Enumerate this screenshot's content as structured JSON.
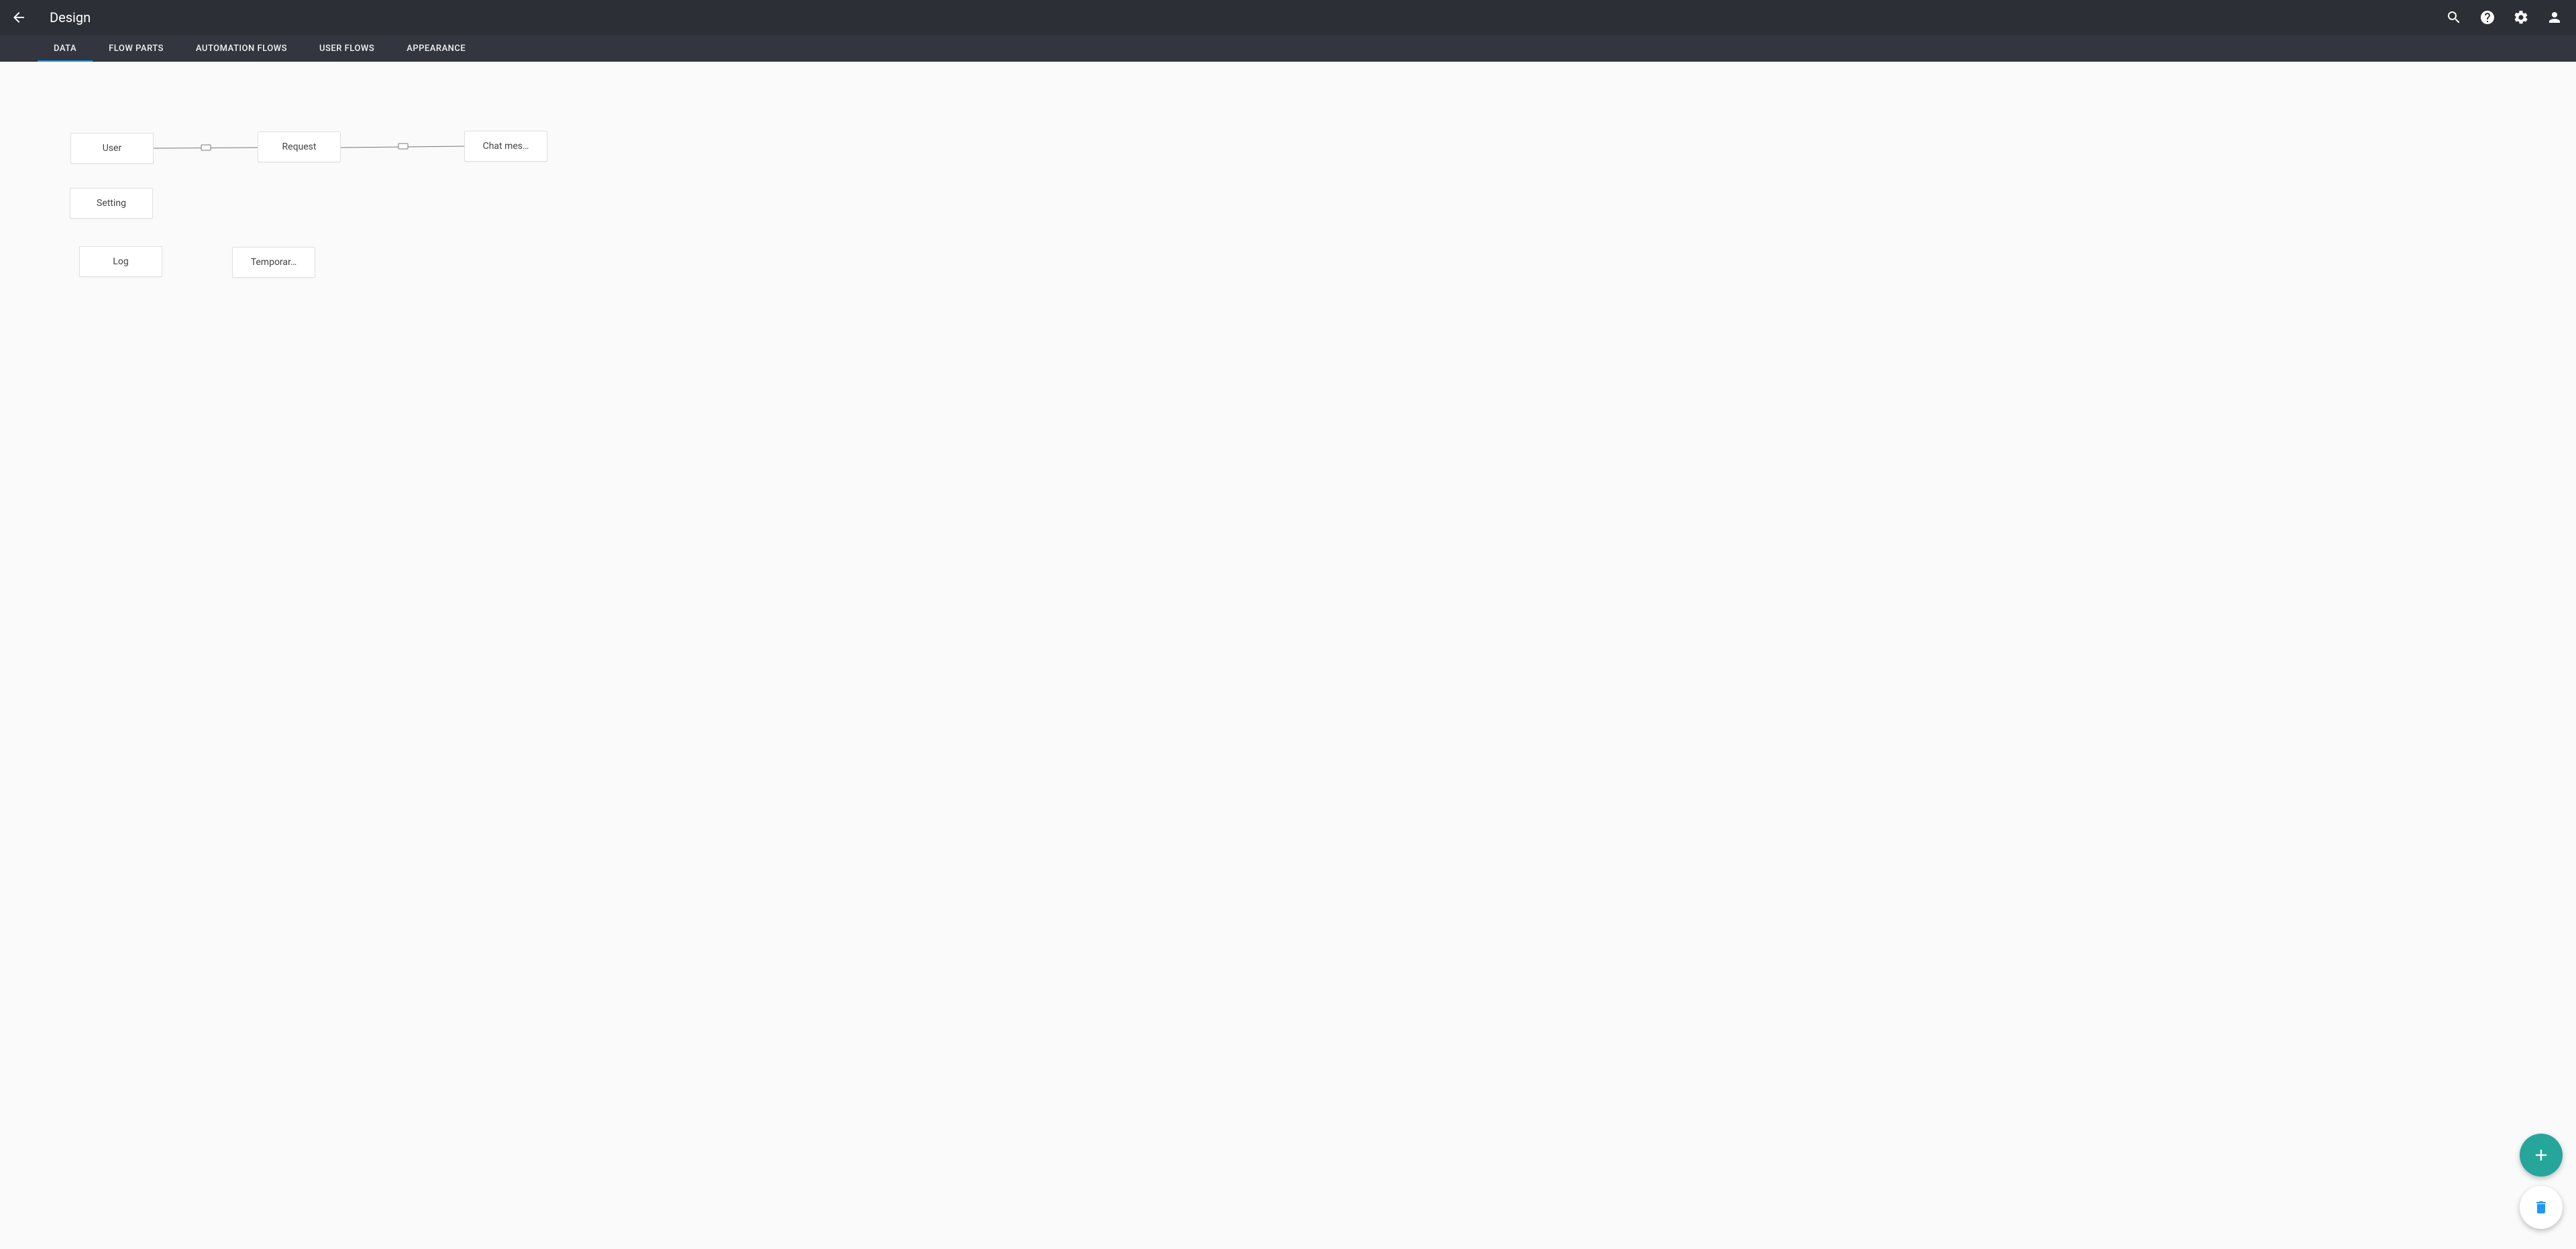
{
  "header": {
    "title": "Design"
  },
  "tabs": [
    {
      "label": "DATA",
      "active": true
    },
    {
      "label": "FLOW PARTS",
      "active": false
    },
    {
      "label": "AUTOMATION FLOWS",
      "active": false
    },
    {
      "label": "USER FLOWS",
      "active": false
    },
    {
      "label": "APPEARANCE",
      "active": false
    }
  ],
  "nodes": {
    "user": "User",
    "request": "Request",
    "chat_message": "Chat mes…",
    "setting": "Setting",
    "log": "Log",
    "temporary": "Temporar…"
  },
  "colors": {
    "accent_tab": "#2196f3",
    "fab_add": "#26a69a",
    "trash_icon": "#2196f3"
  }
}
